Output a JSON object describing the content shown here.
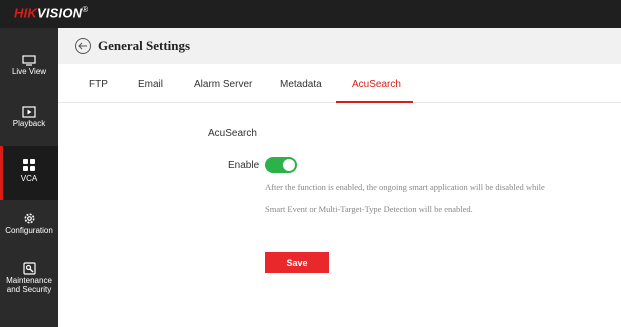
{
  "brand": {
    "name_red": "HIK",
    "name_white": "VISION",
    "mark": "®"
  },
  "sidebar": {
    "items": [
      {
        "label": "Live View",
        "icon": "monitor-icon"
      },
      {
        "label": "Playback",
        "icon": "play-icon"
      },
      {
        "label": "VCA",
        "icon": "grid-icon",
        "active": true
      },
      {
        "label": "Configuration",
        "icon": "gear-icon"
      },
      {
        "label_line1": "Maintenance",
        "label_line2": "and Security",
        "icon": "tools-icon"
      }
    ]
  },
  "header": {
    "title": "General Settings",
    "back_icon": "back-arrow-icon"
  },
  "tabs": [
    {
      "label": "FTP"
    },
    {
      "label": "Email"
    },
    {
      "label": "Alarm Server"
    },
    {
      "label": "Metadata"
    },
    {
      "label": "AcuSearch",
      "active": true
    }
  ],
  "form": {
    "section_title": "AcuSearch",
    "enable_label": "Enable",
    "enable_on": true,
    "help_line1": "After the function is enabled, the ongoing smart application will be disabled while",
    "help_line2": "Smart Event or Multi-Target-Type Detection will be enabled.",
    "save_label": "Save"
  },
  "colors": {
    "accent": "#d91e18",
    "toggle_on": "#2db24a",
    "save": "#e8282b",
    "sidebar_bg": "#2b2b2b",
    "topbar_bg": "#1f1f1f"
  }
}
